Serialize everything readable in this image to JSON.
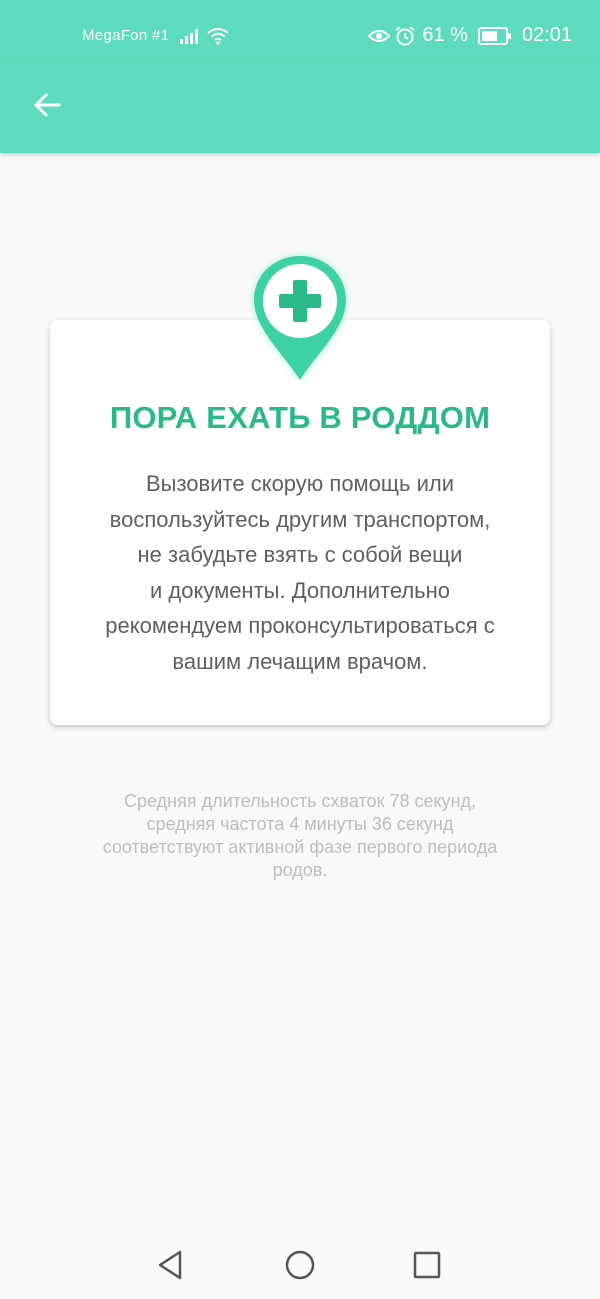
{
  "status_bar": {
    "carrier": "MegaFon #1",
    "battery_percent": "61 %",
    "time": "02:01",
    "icons": [
      "signal-icon",
      "wifi-icon",
      "eye-icon",
      "alarm-icon",
      "battery-icon"
    ]
  },
  "app_bar": {
    "back_icon": "arrow-left-icon",
    "color": "#5cdcbc"
  },
  "card": {
    "icon": "medical-location-pin-icon",
    "title": "ПОРА ЕХАТЬ В РОДДОМ",
    "body_lines": [
      "Вызовите скорую помощь или",
      "воспользуйтесь другим транспортом,",
      "не забудьте взять с собой вещи",
      "и документы. Дополнительно",
      "рекомендуем проконсультироваться с",
      "вашим лечащим врачом."
    ],
    "title_color": "#2bb98a"
  },
  "footnote_lines": [
    "Средняя длительность схваток 78 секунд,",
    "средняя частота 4 минуты 36 секунд",
    "соответствуют активной фазе первого периода",
    "родов."
  ],
  "nav_bar": {
    "buttons": [
      "back-triangle-icon",
      "home-circle-icon",
      "recents-square-icon"
    ]
  }
}
